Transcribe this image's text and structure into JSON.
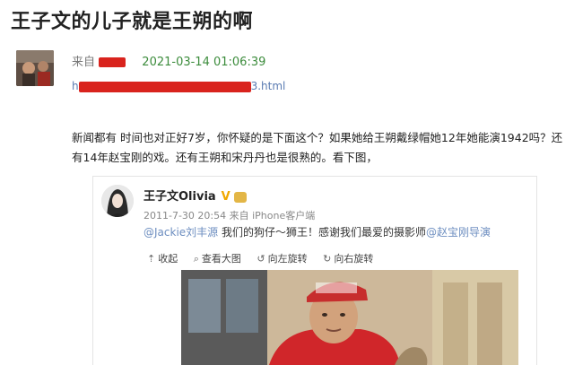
{
  "article": {
    "title": "王子文的儿子就是王朔的啊",
    "from_label": "来自",
    "date": "2021-03-14 01:06:39",
    "url_start": "h",
    "url_end": "3.html",
    "body": "新闻都有 时间也对正好7岁，你怀疑的是下面这个？如果她给王朔戴绿帽她12年她能演1942吗？还有14年赵宝刚的戏。还有王朔和宋丹丹也是很熟的。看下图，"
  },
  "weibo": {
    "name": "王子文Olivia",
    "verified_mark": "V",
    "time": "2011-7-30 20:54 来自 iPhone客户端",
    "mention1": "@Jackie刘丰源",
    "text_mid": " 我们的狗仔～狮王！感谢我们最爱的摄影师",
    "mention2": "@赵宝刚导演",
    "toolbar": [
      {
        "icon": "⇡",
        "label": "收起"
      },
      {
        "icon": "⌕",
        "label": "查看大图"
      },
      {
        "icon": "↺",
        "label": "向左旋转"
      },
      {
        "icon": "↻",
        "label": "向右旋转"
      }
    ]
  },
  "colors": {
    "redaction": "#d9231d",
    "date_green": "#3c8c3c",
    "link_blue": "#5a7bb2",
    "mention_blue": "#6d8ec0",
    "badge_gold": "#f0a800"
  }
}
